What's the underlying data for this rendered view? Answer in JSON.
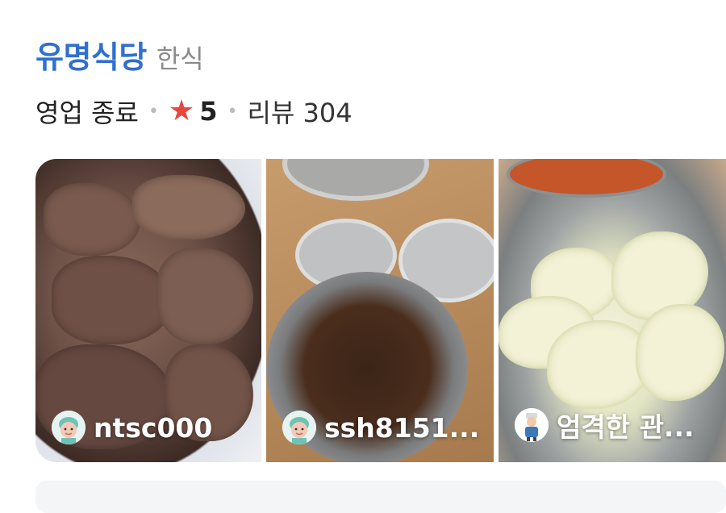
{
  "place": {
    "name": "유명식당",
    "category": "한식",
    "status": "영업 종료",
    "rating": "5",
    "reviews_label": "리뷰 304"
  },
  "photos": [
    {
      "user": "ntsc000",
      "avatar": "avatar-face-icon"
    },
    {
      "user": "ssh8151...",
      "avatar": "avatar-face-icon"
    },
    {
      "user": "엄격한 관...",
      "avatar": "avatar-chef-icon"
    }
  ],
  "colors": {
    "name": "#2f6fd0",
    "star": "#e8463f",
    "muted": "#8a8a8a"
  }
}
